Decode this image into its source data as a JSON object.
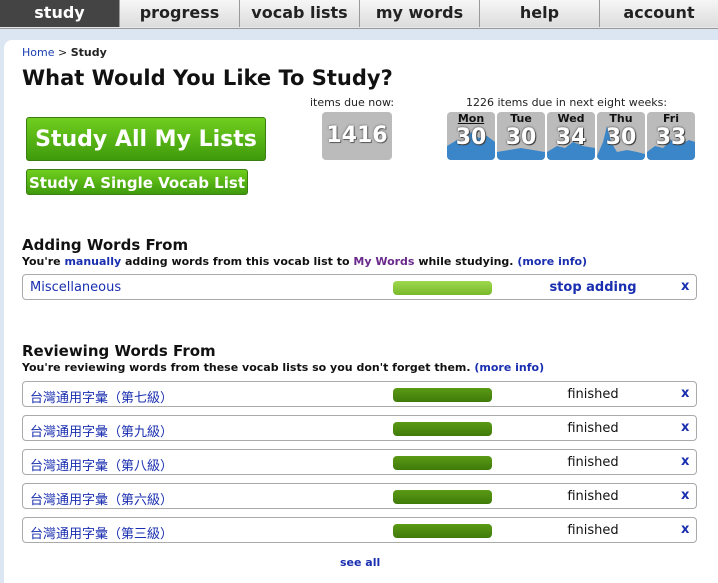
{
  "nav": {
    "tabs": [
      "study",
      "progress",
      "vocab lists",
      "my words",
      "help",
      "account"
    ]
  },
  "breadcrumb": {
    "home": "Home",
    "sep": ">",
    "current": "Study"
  },
  "heading": "What Would You Like To Study?",
  "buttons": {
    "study_all": "Study All My Lists",
    "study_single": "Study A Single Vocab List"
  },
  "due_now": {
    "label": "items due now:",
    "value": "1416"
  },
  "forecast": {
    "label": "1226 items due in next eight weeks:",
    "days": [
      {
        "name": "Mon",
        "value": "30"
      },
      {
        "name": "Tue",
        "value": "30"
      },
      {
        "name": "Wed",
        "value": "34"
      },
      {
        "name": "Thu",
        "value": "30"
      },
      {
        "name": "Fri",
        "value": "33"
      }
    ]
  },
  "adding": {
    "title": "Adding Words From",
    "sub_pre": "You're",
    "sub_link1": "manually",
    "sub_mid": "adding words from this vocab list to",
    "sub_link2": "My Words",
    "sub_post": "while studying.",
    "more": "(more info)",
    "list": {
      "name": "Miscellaneous",
      "action": "stop adding",
      "remove": "x",
      "progress": 1.0
    }
  },
  "reviewing": {
    "title": "Reviewing Words From",
    "sub": "You're reviewing words from these vocab lists so you don't forget them.",
    "more": "(more info)",
    "lists": [
      {
        "name": "台灣通用字彙（第七級）",
        "status": "finished",
        "remove": "x",
        "progress": 1.0
      },
      {
        "name": "台灣通用字彙（第九級）",
        "status": "finished",
        "remove": "x",
        "progress": 1.0
      },
      {
        "name": "台灣通用字彙（第八級）",
        "status": "finished",
        "remove": "x",
        "progress": 1.0
      },
      {
        "name": "台灣通用字彙（第六級）",
        "status": "finished",
        "remove": "x",
        "progress": 1.0
      },
      {
        "name": "台灣通用字彙（第三級）",
        "status": "finished",
        "remove": "x",
        "progress": 1.0
      }
    ],
    "see_all": "see all"
  },
  "colors": {
    "accent_green": "#4aa814",
    "bar_light": "#8ccc3c",
    "bar_dark": "#4e8c10",
    "link": "#1a2fb0",
    "mywords": "#6a2a8c",
    "chart_blue": "#3b86c8"
  }
}
